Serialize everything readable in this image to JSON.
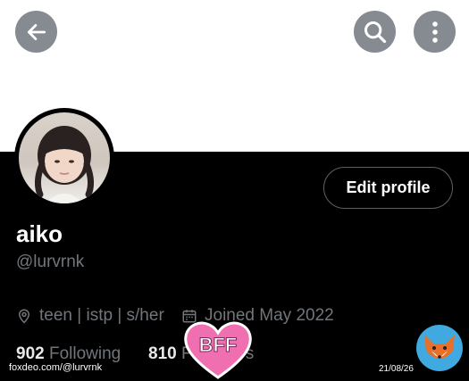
{
  "profile": {
    "name": "aiko",
    "handle": "@lurvrnk",
    "bio": "teen | istp | s/her",
    "joined": "Joined May 2022",
    "following_count": "902",
    "following_label": "Following",
    "followers_count": "810",
    "followers_label": "Followers",
    "edit_label": "Edit profile"
  },
  "sticker": {
    "text": "BFF"
  },
  "watermark": {
    "site": "foxdeo.com/@lurvrnk",
    "date": "21/08/26"
  },
  "icons": [
    "back-arrow-icon",
    "search-icon",
    "more-vertical-icon",
    "location-pin-icon",
    "calendar-icon"
  ],
  "colors": {
    "banner": "#ffffff",
    "background": "#000000",
    "muted": "#71767b",
    "button": "#858b91",
    "sticker": "#f06fb0"
  }
}
